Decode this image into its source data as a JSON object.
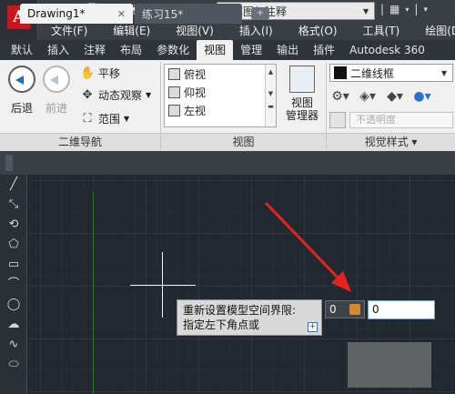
{
  "qat": {
    "workspace": "草图与注释"
  },
  "menu": [
    "文件(F)",
    "编辑(E)",
    "视图(V)",
    "插入(I)",
    "格式(O)",
    "工具(T)",
    "绘图(D)"
  ],
  "ribbon_tabs": [
    "默认",
    "插入",
    "注释",
    "布局",
    "参数化",
    "视图",
    "管理",
    "输出",
    "插件",
    "Autodesk 360"
  ],
  "active_tab": "视图",
  "nav_panel": {
    "back": "后退",
    "forward": "前进",
    "pan": "平移",
    "orbit": "动态观察",
    "extent": "范围",
    "title": "二维导航"
  },
  "views_panel": {
    "items": [
      "俯视",
      "仰视",
      "左视"
    ],
    "manager_line1": "视图",
    "manager_line2": "管理器",
    "title": "视图"
  },
  "visual_styles_panel": {
    "style": "二维线框",
    "opacity_placeholder": "不透明度",
    "title": "视觉样式 ▾"
  },
  "doc_tabs": {
    "active": "Drawing1*",
    "inactive": "练习15*"
  },
  "tooltip": {
    "line1": "重新设置模型空间界限:",
    "line2": "指定左下角点或"
  },
  "inputs": {
    "x_value": "0",
    "y_value": "0"
  },
  "colors": {
    "canvas": "#212830",
    "arrow": "#e8231f"
  }
}
